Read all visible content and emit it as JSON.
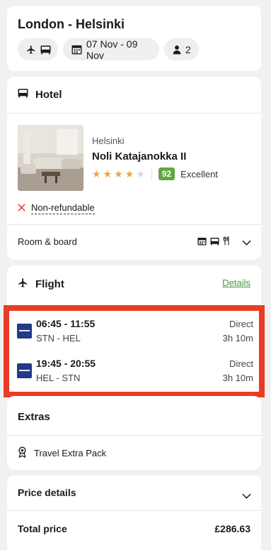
{
  "summary": {
    "title": "London - Helsinki",
    "dates": "07 Nov - 09 Nov",
    "travellers": "2"
  },
  "hotel": {
    "section_title": "Hotel",
    "city": "Helsinki",
    "name": "Noli Katajanokka II",
    "stars": 4,
    "score": "92",
    "score_label": "Excellent",
    "cancellation": "Non-refundable",
    "room_board_label": "Room & board"
  },
  "flight": {
    "section_title": "Flight",
    "details_label": "Details",
    "segments": [
      {
        "times": "06:45 - 11:55",
        "route": "STN - HEL",
        "stops": "Direct",
        "duration": "3h 10m"
      },
      {
        "times": "19:45 - 20:55",
        "route": "HEL - STN",
        "stops": "Direct",
        "duration": "3h 10m"
      }
    ]
  },
  "extras": {
    "section_title": "Extras",
    "item": "Travel Extra Pack"
  },
  "price": {
    "section_title": "Price details",
    "total_label": "Total price",
    "total_value": "£286.63"
  },
  "colors": {
    "accent_green": "#3e9b3e",
    "score_green": "#5fa83f",
    "highlight_red": "#ea3b24",
    "star_orange": "#f2a23c"
  },
  "icons": [
    "plane-icon",
    "bed-icon",
    "calendar-icon",
    "person-icon",
    "close-icon",
    "meal-icon",
    "cutlery-icon",
    "chevron-down-icon",
    "badge-icon",
    "airline-logo"
  ]
}
